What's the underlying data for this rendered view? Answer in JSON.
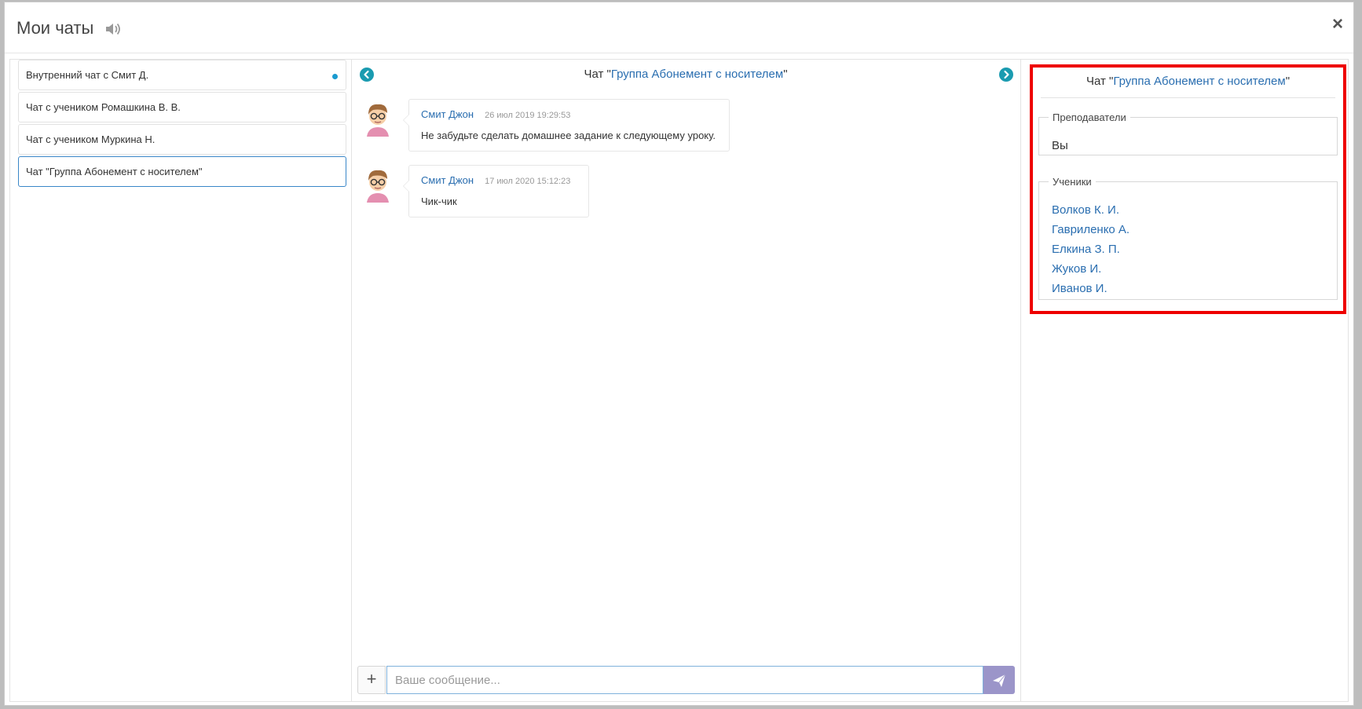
{
  "window": {
    "title": "Мои чаты",
    "close_label": "×"
  },
  "chat_list": [
    {
      "label": "Внутренний чат с Смит Д.",
      "unread": true,
      "active": false
    },
    {
      "label": "Чат с учеником Ромашкина В. В.",
      "unread": false,
      "active": false
    },
    {
      "label": "Чат с учеником Муркина Н.",
      "unread": false,
      "active": false
    },
    {
      "label": "Чат \"Группа Абонемент с носителем\"",
      "unread": false,
      "active": true
    }
  ],
  "chat": {
    "header_prefix": "Чат \"",
    "header_name": "Группа Абонемент с носителем",
    "header_suffix": "\"",
    "messages": [
      {
        "author": "Смит Джон",
        "time": "26 июл 2019 19:29:53",
        "text": "Не забудьте сделать домашнее задание к следующему уроку."
      },
      {
        "author": "Смит Джон",
        "time": "17 июл 2020 15:12:23",
        "text": "Чик-чик"
      }
    ],
    "composer": {
      "attach_label": "+",
      "placeholder": "Ваше сообщение..."
    }
  },
  "info": {
    "title_prefix": "Чат \"",
    "title_name": "Группа Абонемент с носителем",
    "title_suffix": "\"",
    "teachers_legend": "Преподаватели",
    "teachers": [
      "Вы"
    ],
    "students_legend": "Ученики",
    "students": [
      "Волков К. И.",
      "Гавриленко А.",
      "Елкина З. П.",
      "Жуков И.",
      "Иванов И."
    ]
  },
  "colors": {
    "accent": "#2a6eb0",
    "highlight_border": "#ee0000",
    "send_button": "#9b95c9",
    "nav_arrow": "#1a9bb0"
  },
  "icons": [
    "sound-icon",
    "close-icon",
    "chevron-left-icon",
    "chevron-right-icon",
    "avatar",
    "send-icon",
    "plus-icon"
  ]
}
